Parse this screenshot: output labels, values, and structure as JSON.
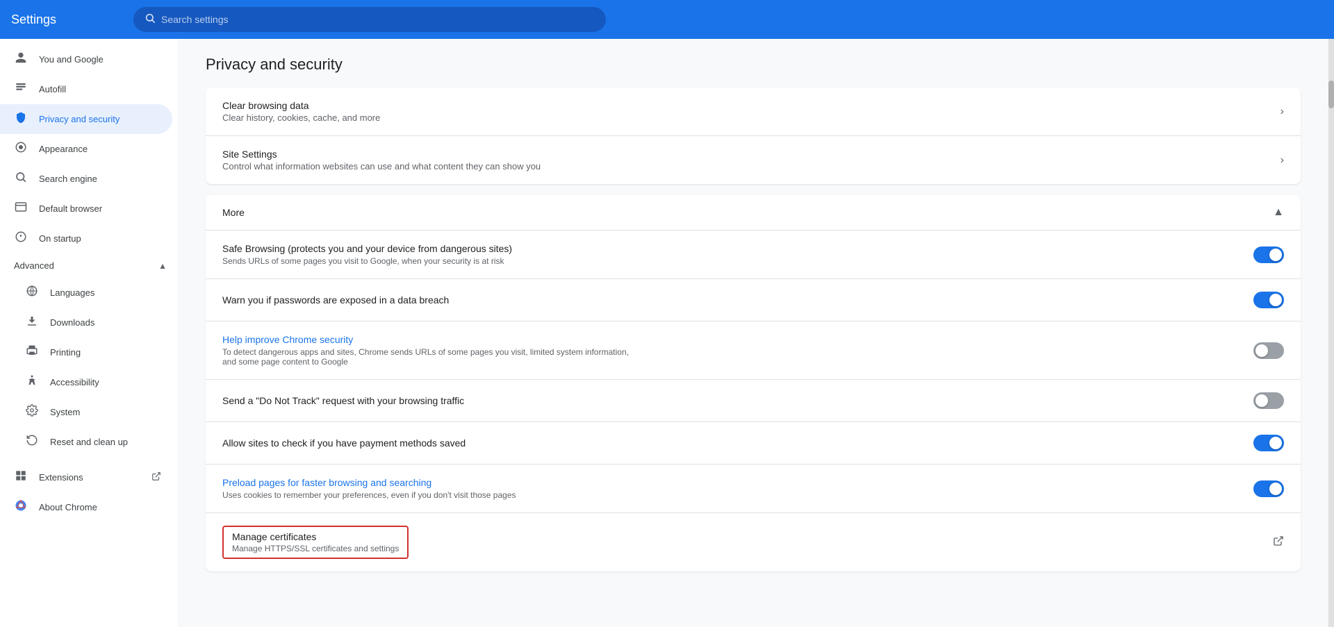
{
  "header": {
    "title": "Settings",
    "search_placeholder": "Search settings"
  },
  "sidebar": {
    "items": [
      {
        "id": "you-and-google",
        "label": "You and Google",
        "icon": "👤"
      },
      {
        "id": "autofill",
        "label": "Autofill",
        "icon": "📋"
      },
      {
        "id": "privacy-and-security",
        "label": "Privacy and security",
        "icon": "🛡️",
        "active": true
      },
      {
        "id": "appearance",
        "label": "Appearance",
        "icon": "🎨"
      },
      {
        "id": "search-engine",
        "label": "Search engine",
        "icon": "🔍"
      },
      {
        "id": "default-browser",
        "label": "Default browser",
        "icon": "🖥️"
      },
      {
        "id": "on-startup",
        "label": "On startup",
        "icon": "⭕"
      }
    ],
    "advanced_section": {
      "label": "Advanced",
      "expanded": true,
      "sub_items": [
        {
          "id": "languages",
          "label": "Languages",
          "icon": "🌐"
        },
        {
          "id": "downloads",
          "label": "Downloads",
          "icon": "⬇️"
        },
        {
          "id": "printing",
          "label": "Printing",
          "icon": "🖨️"
        },
        {
          "id": "accessibility",
          "label": "Accessibility",
          "icon": "♿"
        },
        {
          "id": "system",
          "label": "System",
          "icon": "🔧"
        },
        {
          "id": "reset-and-clean",
          "label": "Reset and clean up",
          "icon": "🔄"
        }
      ]
    },
    "extensions": {
      "label": "Extensions",
      "icon": "⧉"
    },
    "about_chrome": {
      "label": "About Chrome"
    }
  },
  "main": {
    "page_title": "Privacy and security",
    "cards": [
      {
        "id": "clear-browsing-data",
        "title": "Clear browsing data",
        "subtitle": "Clear history, cookies, cache, and more",
        "has_arrow": true
      },
      {
        "id": "site-settings",
        "title": "Site Settings",
        "subtitle": "Control what information websites can use and what content they can show you",
        "has_arrow": true
      }
    ],
    "more_section": {
      "label": "More",
      "expanded": true,
      "toggles": [
        {
          "id": "safe-browsing",
          "title": "Safe Browsing (protects you and your device from dangerous sites)",
          "subtitle": "Sends URLs of some pages you visit to Google, when your security is at risk",
          "state": "on",
          "blue_title": false
        },
        {
          "id": "warn-passwords",
          "title": "Warn you if passwords are exposed in a data breach",
          "subtitle": "",
          "state": "on",
          "blue_title": false
        },
        {
          "id": "help-improve-security",
          "title": "Help improve Chrome security",
          "subtitle": "To detect dangerous apps and sites, Chrome sends URLs of some pages you visit, limited system information, and some page content to Google",
          "state": "off",
          "blue_title": true
        },
        {
          "id": "do-not-track",
          "title": "Send a \"Do Not Track\" request with your browsing traffic",
          "subtitle": "",
          "state": "off",
          "blue_title": false
        },
        {
          "id": "payment-methods",
          "title": "Allow sites to check if you have payment methods saved",
          "subtitle": "",
          "state": "on",
          "blue_title": false
        },
        {
          "id": "preload-pages",
          "title": "Preload pages for faster browsing and searching",
          "subtitle": "Uses cookies to remember your preferences, even if you don't visit those pages",
          "state": "on",
          "blue_title": true
        }
      ],
      "cert_row": {
        "id": "manage-certificates",
        "title": "Manage certificates",
        "subtitle": "Manage HTTPS/SSL certificates and settings",
        "highlighted": true
      }
    }
  }
}
